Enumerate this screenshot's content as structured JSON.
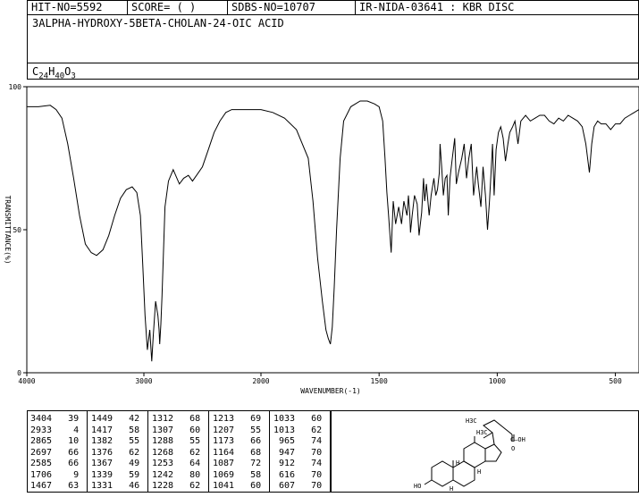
{
  "header": {
    "hit_no": "HIT-NO=5592",
    "score": "SCORE=  (   )",
    "sdbs_no": "SDBS-NO=10707",
    "ir_id": "IR-NIDA-03641 : KBR DISC"
  },
  "compound_name": "3ALPHA-HYDROXY-5BETA-CHOLAN-24-OIC ACID",
  "formula": {
    "c": "C",
    "c_n": "24",
    "h": "H",
    "h_n": "40",
    "o": "O",
    "o_n": "3"
  },
  "chart_data": {
    "type": "line",
    "title": "",
    "xlabel": "WAVENUMBER(-1)",
    "ylabel": "TRANSMITTANCE(%)",
    "xlim": [
      4000,
      400
    ],
    "ylim": [
      0,
      100
    ],
    "x_ticks": [
      4000,
      3000,
      2000,
      1500,
      1000,
      500
    ],
    "x_tick_labels": [
      "4000",
      "3000",
      "2000",
      "1500",
      "1000",
      "500"
    ],
    "y_ticks": [
      0,
      50,
      100
    ],
    "y_tick_labels": [
      "0",
      "50",
      "100"
    ],
    "grid": false,
    "series": [
      {
        "x": [
          4000,
          3900,
          3800,
          3750,
          3700,
          3650,
          3600,
          3550,
          3500,
          3450,
          3404,
          3350,
          3300,
          3250,
          3200,
          3150,
          3100,
          3060,
          3030,
          3010,
          2990,
          2970,
          2950,
          2933,
          2920,
          2900,
          2880,
          2870,
          2865,
          2855,
          2845,
          2820,
          2790,
          2750,
          2697,
          2660,
          2620,
          2585,
          2550,
          2500,
          2450,
          2400,
          2350,
          2300,
          2250,
          2200,
          2100,
          2000,
          1950,
          1900,
          1850,
          1800,
          1780,
          1760,
          1740,
          1725,
          1715,
          1706,
          1698,
          1690,
          1680,
          1665,
          1650,
          1620,
          1580,
          1550,
          1520,
          1500,
          1485,
          1475,
          1467,
          1460,
          1449,
          1440,
          1430,
          1417,
          1405,
          1395,
          1382,
          1376,
          1370,
          1367,
          1360,
          1350,
          1339,
          1331,
          1320,
          1312,
          1307,
          1300,
          1288,
          1280,
          1268,
          1260,
          1253,
          1245,
          1242,
          1235,
          1228,
          1220,
          1213,
          1207,
          1200,
          1190,
          1180,
          1173,
          1164,
          1150,
          1140,
          1130,
          1120,
          1110,
          1100,
          1087,
          1080,
          1069,
          1060,
          1050,
          1041,
          1033,
          1025,
          1020,
          1013,
          1005,
          995,
          985,
          975,
          965,
          955,
          947,
          935,
          925,
          912,
          900,
          880,
          860,
          840,
          820,
          800,
          780,
          760,
          740,
          720,
          700,
          680,
          660,
          640,
          625,
          616,
          610,
          607,
          600,
          590,
          575,
          560,
          540,
          520,
          500,
          480,
          460,
          440,
          420,
          400
        ],
        "y": [
          93,
          93,
          93.5,
          92,
          89,
          80,
          68,
          55,
          45,
          42,
          41,
          43,
          48,
          55,
          61,
          64,
          65,
          63,
          55,
          38,
          20,
          8,
          15,
          4,
          13,
          25,
          20,
          15,
          10,
          17,
          27,
          58,
          67,
          71,
          66,
          68,
          69,
          67,
          69,
          72,
          78,
          84,
          88,
          91,
          92,
          92,
          92,
          92,
          91,
          89,
          85,
          75,
          60,
          40,
          25,
          15,
          12,
          10,
          16,
          30,
          50,
          75,
          88,
          93,
          95,
          95,
          94,
          93,
          88,
          75,
          63,
          55,
          42,
          60,
          52,
          58,
          52,
          60,
          55,
          62,
          55,
          49,
          55,
          62,
          59,
          48,
          56,
          68,
          60,
          66,
          55,
          62,
          68,
          62,
          64,
          70,
          80,
          72,
          62,
          68,
          69,
          55,
          68,
          75,
          82,
          66,
          70,
          75,
          80,
          68,
          75,
          80,
          62,
          72,
          66,
          58,
          72,
          62,
          50,
          60,
          72,
          80,
          62,
          78,
          84,
          86,
          82,
          74,
          80,
          84,
          86,
          88,
          80,
          88,
          90,
          88,
          89,
          90,
          90,
          88,
          87,
          89,
          88,
          90,
          89,
          88,
          86,
          80,
          74,
          70,
          73,
          80,
          86,
          88,
          87,
          87,
          85,
          87,
          87,
          89,
          90,
          91,
          92
        ]
      }
    ]
  },
  "peak_table": [
    [
      "3404",
      "39"
    ],
    [
      "2933",
      "4"
    ],
    [
      "2865",
      "10"
    ],
    [
      "2697",
      "66"
    ],
    [
      "2585",
      "66"
    ],
    [
      "1706",
      "9"
    ],
    [
      "1467",
      "63"
    ],
    [
      "1449",
      "42"
    ],
    [
      "1417",
      "58"
    ],
    [
      "1382",
      "55"
    ],
    [
      "1376",
      "62"
    ],
    [
      "1367",
      "49"
    ],
    [
      "1339",
      "59"
    ],
    [
      "1331",
      "46"
    ],
    [
      "1312",
      "68"
    ],
    [
      "1307",
      "60"
    ],
    [
      "1288",
      "55"
    ],
    [
      "1268",
      "62"
    ],
    [
      "1253",
      "64"
    ],
    [
      "1242",
      "80"
    ],
    [
      "1228",
      "62"
    ],
    [
      "1213",
      "69"
    ],
    [
      "1207",
      "55"
    ],
    [
      "1173",
      "66"
    ],
    [
      "1164",
      "68"
    ],
    [
      "1087",
      "72"
    ],
    [
      "1069",
      "58"
    ],
    [
      "1041",
      "60"
    ],
    [
      "1033",
      "60"
    ],
    [
      "1013",
      "62"
    ],
    [
      "965",
      "74"
    ],
    [
      "947",
      "70"
    ],
    [
      "912",
      "74"
    ],
    [
      "616",
      "70"
    ],
    [
      "607",
      "70"
    ]
  ],
  "structure_labels": {
    "methyl_top": "H3C",
    "methyl_mid": "H3C",
    "acid": "C—OH",
    "carbonyl_o": "O",
    "hydroxyl": "HO",
    "h1": "H",
    "h2": "H",
    "h3": "H"
  }
}
